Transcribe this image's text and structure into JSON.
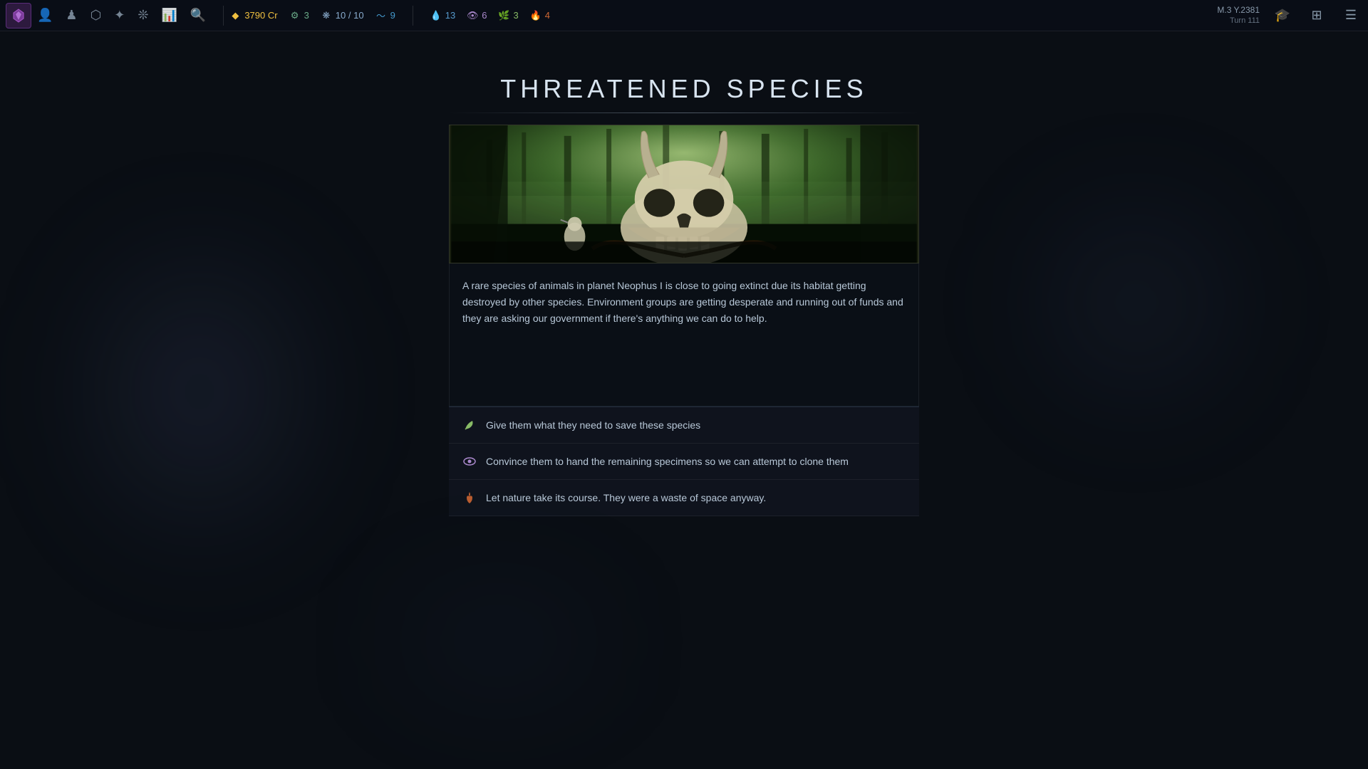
{
  "topnav": {
    "logo_label": "Game Logo",
    "date": "M.3 Y.2381",
    "turn": "Turn 111",
    "resources": [
      {
        "id": "credits",
        "icon": "diamond",
        "value": "3790 Cr",
        "color": "#f0c040"
      },
      {
        "id": "gear",
        "icon": "⚙",
        "value": "3",
        "color": "#6aaa88"
      },
      {
        "id": "population",
        "icon": "❋",
        "value": "10 / 10",
        "color": "#88aacc"
      },
      {
        "id": "water",
        "icon": "◎",
        "value": "9",
        "color": "#4488cc"
      },
      {
        "id": "drops",
        "icon": "💧",
        "value": "13",
        "color": "#5599cc"
      },
      {
        "id": "eye",
        "icon": "👁",
        "value": "6",
        "color": "#aa88cc"
      },
      {
        "id": "leaf",
        "icon": "🌿",
        "value": "3",
        "color": "#88bb66"
      },
      {
        "id": "flame",
        "icon": "🔥",
        "value": "4",
        "color": "#cc6633"
      }
    ],
    "icons": [
      {
        "id": "people",
        "symbol": "👤"
      },
      {
        "id": "pawn",
        "symbol": "♟"
      },
      {
        "id": "ring",
        "symbol": "⬡"
      },
      {
        "id": "star",
        "symbol": "✦"
      },
      {
        "id": "crown",
        "symbol": "❊"
      },
      {
        "id": "chart",
        "symbol": "📊"
      },
      {
        "id": "search",
        "symbol": "🔍"
      }
    ],
    "right_buttons": [
      {
        "id": "cap",
        "symbol": "🎓"
      },
      {
        "id": "layers",
        "symbol": "⊞"
      },
      {
        "id": "menu",
        "symbol": "☰"
      }
    ]
  },
  "event": {
    "title": "THREATENED SPECIES",
    "title_line": true,
    "description": "A rare species of animals in planet Neophus I is close to going extinct due its habitat getting destroyed by other species. Environment groups are getting desperate and running out of funds and they are asking our government if there's anything we can do to help.",
    "choices": [
      {
        "id": "choice-save",
        "icon": "leaf",
        "icon_symbol": "🌿",
        "label": "Give them what they need to save these species"
      },
      {
        "id": "choice-clone",
        "icon": "eye",
        "icon_symbol": "👁",
        "label": "Convince them to hand the remaining specimens so we can attempt to clone them"
      },
      {
        "id": "choice-ignore",
        "icon": "flame",
        "icon_symbol": "🔥",
        "label": "Let nature take its course. They were a waste of space anyway."
      }
    ]
  }
}
